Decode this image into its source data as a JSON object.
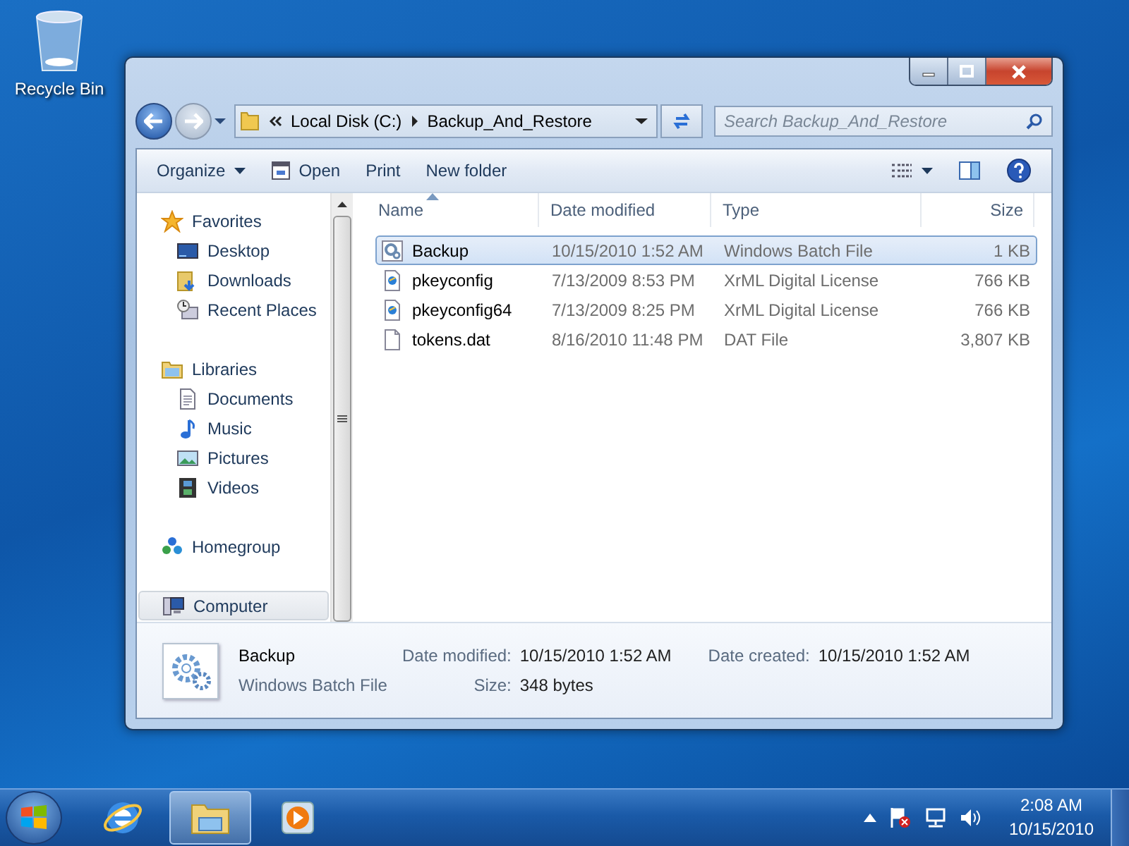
{
  "desktop_icons": [
    {
      "label": "Recycle Bin"
    }
  ],
  "window": {
    "address": {
      "path": [
        "Local Disk (C:)",
        "Backup_And_Restore"
      ]
    },
    "search": {
      "placeholder": "Search Backup_And_Restore"
    },
    "toolbar": [
      {
        "label": "Organize",
        "kind": "menu"
      },
      {
        "label": "Open",
        "kind": "open"
      },
      {
        "label": "Print",
        "kind": "plain"
      },
      {
        "label": "New folder",
        "kind": "plain"
      }
    ],
    "nav": [
      {
        "label": "Favorites",
        "kind": "star",
        "selected": false,
        "children": [
          {
            "label": "Desktop",
            "kind": "desktop",
            "selected": false
          },
          {
            "label": "Downloads",
            "kind": "downloads",
            "selected": false
          },
          {
            "label": "Recent Places",
            "kind": "recent",
            "selected": false
          }
        ]
      },
      {
        "label": "Libraries",
        "kind": "libraries",
        "selected": false,
        "children": [
          {
            "label": "Documents",
            "kind": "documents",
            "selected": false
          },
          {
            "label": "Music",
            "kind": "music",
            "selected": false
          },
          {
            "label": "Pictures",
            "kind": "pictures",
            "selected": false
          },
          {
            "label": "Videos",
            "kind": "videos",
            "selected": false
          }
        ]
      },
      {
        "label": "Homegroup",
        "kind": "homegroup",
        "selected": false
      },
      {
        "label": "Computer",
        "kind": "computer",
        "selected": true
      }
    ],
    "columns": [
      {
        "label": "Name",
        "sorted": true
      },
      {
        "label": "Date modified",
        "sorted": false
      },
      {
        "label": "Type",
        "sorted": false
      },
      {
        "label": "Size",
        "sorted": false
      }
    ],
    "files": [
      {
        "name": "Backup",
        "date": "10/15/2010 1:52 AM",
        "type": "Windows Batch File",
        "size": "1 KB",
        "kind": "batch",
        "selected": true
      },
      {
        "name": "pkeyconfig",
        "date": "7/13/2009 8:53 PM",
        "type": "XrML Digital License",
        "size": "766 KB",
        "kind": "license",
        "selected": false
      },
      {
        "name": "pkeyconfig64",
        "date": "7/13/2009 8:25 PM",
        "type": "XrML Digital License",
        "size": "766 KB",
        "kind": "license",
        "selected": false
      },
      {
        "name": "tokens.dat",
        "date": "8/16/2010 11:48 PM",
        "type": "DAT File",
        "size": "3,807 KB",
        "kind": "blank",
        "selected": false
      }
    ],
    "details": {
      "name": "Backup",
      "type": "Windows Batch File",
      "fields": [
        {
          "label": "Date modified:",
          "value": "10/15/2010 1:52 AM"
        },
        {
          "label": "Date created:",
          "value": "10/15/2010 1:52 AM"
        },
        {
          "label": "Size:",
          "value": "348 bytes"
        }
      ]
    }
  },
  "taskbar": {
    "apps": [
      {
        "kind": "browser",
        "selected": false
      },
      {
        "kind": "explorer",
        "selected": true
      },
      {
        "kind": "media",
        "selected": false
      }
    ],
    "clock": {
      "time": "2:08 AM",
      "date": "10/15/2010"
    }
  }
}
